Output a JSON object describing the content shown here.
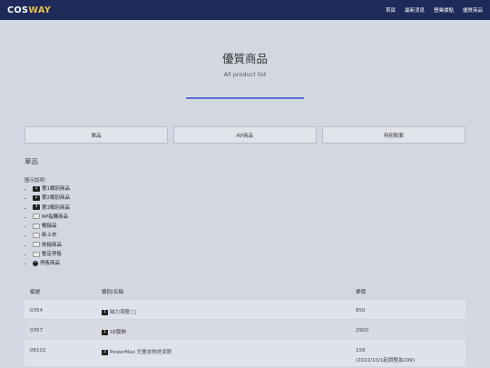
{
  "header": {
    "logo_a": "COS",
    "logo_b": "WAY",
    "nav": [
      "首頁",
      "最新消息",
      "營業據點",
      "優質商品"
    ]
  },
  "hero": {
    "title": "優質商品",
    "subtitle": "All product list"
  },
  "tabs": [
    "單品",
    "RP商品",
    "特別配套"
  ],
  "section_title": "單品",
  "legend": {
    "title": "圖示說明:",
    "items": [
      {
        "badge": "1",
        "label": "第1類別商品"
      },
      {
        "badge": "2",
        "label": "第2類別商品"
      },
      {
        "badge": "3",
        "label": "第3類別商品"
      },
      {
        "badge": "",
        "label": "RP指購商品"
      },
      {
        "badge": "",
        "label": "暢銷品"
      },
      {
        "badge": "",
        "label": "新上市"
      },
      {
        "badge": "",
        "label": "熱銷商品"
      },
      {
        "badge": "",
        "label": "暫定停售"
      },
      {
        "badge": "",
        "label": "停售商品"
      }
    ]
  },
  "table": {
    "headers": [
      "編號",
      "類別/名稱",
      "單價"
    ],
    "rows": [
      {
        "id": "0354",
        "badge": "1",
        "name": "磁力項圈",
        "price": "850",
        "price_note": ""
      },
      {
        "id": "0357",
        "badge": "1",
        "name": "SE腹飾",
        "price": "2900",
        "price_note": ""
      },
      {
        "id": "08102",
        "badge": "2",
        "name": "PowerMax 兒童衣物洗潔劑",
        "price": "158",
        "price_note": "(2022/10/1起調整為199)"
      }
    ]
  }
}
